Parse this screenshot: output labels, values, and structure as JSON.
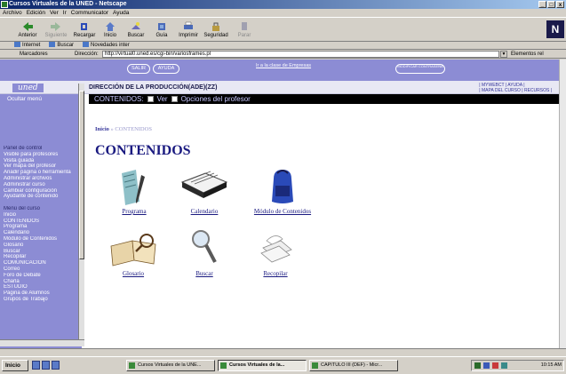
{
  "window": {
    "title": "Cursos Virtuales de la UNED - Netscape",
    "controls": [
      "_",
      "□",
      "x"
    ]
  },
  "menubar": [
    "Archivo",
    "Edición",
    "Ver",
    "Ir",
    "Communicator",
    "Ayuda"
  ],
  "toolbar": [
    {
      "label": "Anterior",
      "icon": "back-arrow-icon",
      "enabled": true
    },
    {
      "label": "Siguiente",
      "icon": "forward-arrow-icon",
      "enabled": false
    },
    {
      "label": "Recargar",
      "icon": "reload-icon",
      "enabled": true
    },
    {
      "label": "Inicio",
      "icon": "home-icon",
      "enabled": true
    },
    {
      "label": "Buscar",
      "icon": "search-icon",
      "enabled": true
    },
    {
      "label": "Guía",
      "icon": "guide-icon",
      "enabled": true
    },
    {
      "label": "Imprimir",
      "icon": "print-icon",
      "enabled": true
    },
    {
      "label": "Seguridad",
      "icon": "security-icon",
      "enabled": true
    },
    {
      "label": "Parar",
      "icon": "stop-icon",
      "enabled": false
    }
  ],
  "personal_toolbar": [
    "Internet",
    "Buscar",
    "Novedades inter"
  ],
  "location": {
    "bookmarks_label": "Marcadores",
    "address_label": "Dirección:",
    "url": "http://virtual0.uned.es/cgi-bin/variosframes.pl",
    "related_label": "Elementos rel"
  },
  "page": {
    "top_buttons": [
      "SALIR",
      "AYUDA"
    ],
    "top_link": "Ir a la clase de Empresas",
    "top_right_button": "MODIFICAR CONTRASEÑA",
    "logo_text": "uned",
    "course_title": "DIRECCIÓN DE LA PRODUCCIÓN(ADE)(ZZ)",
    "header_links_line1": "| MYWEBCT | AYUDA |",
    "header_links_line2": "| MAPA DEL CURSO | RECURSOS |",
    "contenidos_bar": {
      "label": "CONTENIDOS:",
      "ver": "Ver",
      "opciones": "Opciones del profesor"
    },
    "breadcrumb": {
      "home": "Inicio",
      "separator": "»",
      "current": "CONTENIDOS"
    },
    "heading": "CONTENIDOS",
    "items": [
      {
        "label": "Programa",
        "icon": "booklet-pen-icon"
      },
      {
        "label": "Calendario",
        "icon": "calendar-icon"
      },
      {
        "label": "Módulo de Contenidos",
        "icon": "backpack-icon"
      },
      {
        "label": "Glosario",
        "icon": "open-book-icon"
      },
      {
        "label": "Buscar",
        "icon": "magnifier-icon"
      },
      {
        "label": "Recopilar",
        "icon": "paper-stack-icon"
      }
    ]
  },
  "sidebar": {
    "hide_menu": "Ocultar menú",
    "items": [
      {
        "text": "Panel de control",
        "header": true
      },
      {
        "text": "Visible para profesores",
        "header": false
      },
      {
        "text": "Visita guiada",
        "header": false
      },
      {
        "text": "Ver mapa del profesor",
        "header": false
      },
      {
        "text": "Añadir página o herramienta",
        "header": false
      },
      {
        "text": "Administrar archivos",
        "header": false
      },
      {
        "text": "Administrar curso",
        "header": false
      },
      {
        "text": "Cambiar configuración",
        "header": false
      },
      {
        "text": "Ayudante de contenido",
        "header": false
      },
      {
        "text": "",
        "header": false
      },
      {
        "text": "Menú del curso",
        "header": true
      },
      {
        "text": "Inicio",
        "header": false
      },
      {
        "text": "CONTENIDOS",
        "header": false
      },
      {
        "text": "Programa",
        "header": false
      },
      {
        "text": "Calendario",
        "header": false
      },
      {
        "text": "Módulo de Contenidos",
        "header": false
      },
      {
        "text": "Glosario",
        "header": false
      },
      {
        "text": "Buscar",
        "header": false
      },
      {
        "text": "Recopilar",
        "header": false
      },
      {
        "text": "COMUNICACIÓN",
        "header": false
      },
      {
        "text": "Correo",
        "header": false
      },
      {
        "text": "Foro de Debate",
        "header": false
      },
      {
        "text": "Charla",
        "header": false
      },
      {
        "text": "ESTUDIO",
        "header": false
      },
      {
        "text": "Página de Alumnos",
        "header": false
      },
      {
        "text": "Grupos de Trabajo",
        "header": false
      }
    ]
  },
  "taskbar": {
    "start": "Inicio",
    "tasks": [
      {
        "label": "Cursos Virtuales de la UNE...",
        "active": false
      },
      {
        "label": "Cursos Virtuales de la...",
        "active": true
      },
      {
        "label": "CAPITULO III (DEF) - Micr...",
        "active": false
      }
    ],
    "clock": "10:15 AM"
  },
  "colors": {
    "page_purple": "#8c8cd4",
    "link_blue": "#1a1a80",
    "black_bar": "#000000"
  }
}
